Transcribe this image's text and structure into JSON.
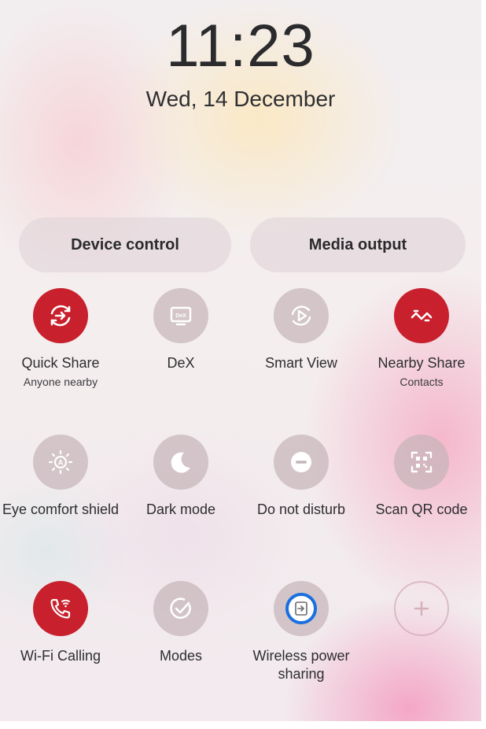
{
  "lockscreen": {
    "time": "11:23",
    "date": "Wed, 14 December"
  },
  "panel_buttons": {
    "device_control": "Device control",
    "media_output": "Media output"
  },
  "tiles": [
    {
      "label": "Quick Share",
      "sublabel": "Anyone nearby",
      "state": "on",
      "icon": "quick-share-icon"
    },
    {
      "label": "DeX",
      "sublabel": "",
      "state": "off",
      "icon": "dex-icon"
    },
    {
      "label": "Smart View",
      "sublabel": "",
      "state": "off",
      "icon": "smart-view-icon"
    },
    {
      "label": "Nearby Share",
      "sublabel": "Contacts",
      "state": "on",
      "icon": "nearby-share-icon"
    },
    {
      "label": "Eye comfort shield",
      "sublabel": "",
      "state": "off",
      "icon": "eye-comfort-icon"
    },
    {
      "label": "Dark mode",
      "sublabel": "",
      "state": "off",
      "icon": "moon-icon"
    },
    {
      "label": "Do not disturb",
      "sublabel": "",
      "state": "off",
      "icon": "minus-circle-icon"
    },
    {
      "label": "Scan QR code",
      "sublabel": "",
      "state": "off",
      "icon": "qr-code-icon"
    },
    {
      "label": "Wi-Fi Calling",
      "sublabel": "",
      "state": "on",
      "icon": "wifi-calling-icon"
    },
    {
      "label": "Modes",
      "sublabel": "",
      "state": "off",
      "icon": "modes-check-icon"
    },
    {
      "label": "Wireless power sharing",
      "sublabel": "",
      "state": "off",
      "icon": "wireless-power-sharing-icon"
    },
    {
      "label": "",
      "sublabel": "",
      "state": "empty",
      "icon": "plus-icon"
    }
  ],
  "colors": {
    "active_tile": "#c8202c",
    "inactive_tile": "#c4b4b8",
    "focus_ring": "#1a6fe0"
  }
}
